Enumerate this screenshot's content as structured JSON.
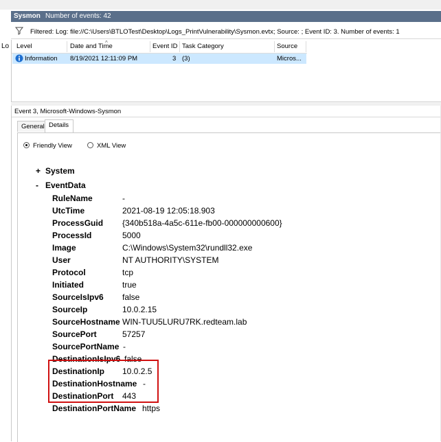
{
  "header": {
    "log_name": "Sysmon",
    "events_count": "Number of events: 42"
  },
  "filter": {
    "text": "Filtered: Log: file://C:\\Users\\BTLOTest\\Desktop\\Logs_PrintVulnerability\\Sysmon.evtx; Source: ; Event ID: 3. Number of events: 1"
  },
  "left_panel": {
    "label": "Lo"
  },
  "table": {
    "columns": [
      "Level",
      "Date and Time",
      "Event ID",
      "Task Category",
      "Source"
    ],
    "rows": [
      {
        "level": "Information",
        "datetime": "8/19/2021 12:11:09 PM",
        "event_id": "3",
        "task_category": "(3)",
        "source": "Micros..."
      }
    ]
  },
  "event_panel": {
    "title": "Event 3, Microsoft-Windows-Sysmon",
    "tabs": [
      "General",
      "Details"
    ],
    "active_tab": "Details",
    "views": {
      "friendly": "Friendly View",
      "xml": "XML View",
      "selected": "friendly"
    }
  },
  "details": {
    "system": {
      "toggle": "+",
      "label": "System"
    },
    "eventdata": {
      "toggle": "-",
      "label": "EventData"
    },
    "fields": [
      {
        "key": "RuleName",
        "value": "-"
      },
      {
        "key": "UtcTime",
        "value": "2021-08-19 12:05:18.903"
      },
      {
        "key": "ProcessGuid",
        "value": "{340b518a-4a5c-611e-fb00-000000000600}"
      },
      {
        "key": "ProcessId",
        "value": "5000"
      },
      {
        "key": "Image",
        "value": "C:\\Windows\\System32\\rundll32.exe"
      },
      {
        "key": "User",
        "value": "NT AUTHORITY\\SYSTEM"
      },
      {
        "key": "Protocol",
        "value": "tcp"
      },
      {
        "key": "Initiated",
        "value": "true"
      },
      {
        "key": "SourceIsIpv6",
        "value": "false"
      },
      {
        "key": "SourceIp",
        "value": "10.0.2.15"
      },
      {
        "key": "SourceHostname",
        "value": "WIN-TUU5LURU7RK.redteam.lab"
      },
      {
        "key": "SourcePort",
        "value": "57257"
      },
      {
        "key": "SourcePortName",
        "value": "-"
      },
      {
        "key": "DestinationIsIpv6",
        "value": "false"
      },
      {
        "key": "DestinationIp",
        "value": "10.0.2.5"
      },
      {
        "key": "DestinationHostname",
        "value": "-"
      },
      {
        "key": "DestinationPort",
        "value": "443"
      },
      {
        "key": "DestinationPortName",
        "value": "https"
      }
    ]
  },
  "colors": {
    "header_bg": "#5a6f8a",
    "selected_row": "#cce8ff",
    "highlight_box": "#d01010",
    "info_icon": "#1e6fd0"
  }
}
